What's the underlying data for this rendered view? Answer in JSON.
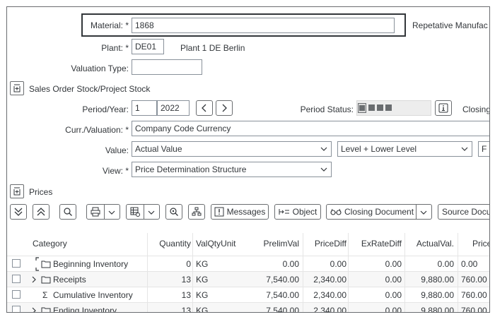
{
  "header": {
    "material_label": "Material: *",
    "material_value": "1868",
    "repetitive_label": "Repetative Manufac",
    "plant_label": "Plant: *",
    "plant_value": "DE01",
    "plant_desc": "Plant 1 DE Berlin",
    "valuation_type_label": "Valuation Type:",
    "valuation_type_value": "",
    "sales_order_section": "Sales Order Stock/Project Stock",
    "period_label": "Period/Year:",
    "period_value": "1",
    "year_value": "2022",
    "period_status_label": "Period Status:",
    "closing_label": "Closing",
    "curr_label": "Curr./Valuation: *",
    "curr_value": "Company Code Currency",
    "value_label": "Value:",
    "value_value": "Actual Value",
    "level_value": "Level + Lower Level",
    "extra_value": "F",
    "view_label": "View: *",
    "view_value": "Price Determination Structure",
    "prices_section": "Prices"
  },
  "toolbar": {
    "messages": "Messages",
    "object": "Object",
    "closing_document": "Closing Document",
    "source_doc": "Source Docu"
  },
  "table": {
    "headers": [
      "Category",
      "Quantity",
      "ValQtyUnit",
      "PrelimVal",
      "PriceDiff",
      "ExRateDiff",
      "ActualVal.",
      "Price"
    ],
    "rows": [
      {
        "category": "Beginning Inventory",
        "quantity": "0",
        "unit": "KG",
        "prelim": "0.00",
        "pricediff": "0.00",
        "exrate": "0.00",
        "actual": "0.00",
        "price": "0.00"
      },
      {
        "category": "Receipts",
        "quantity": "13",
        "unit": "KG",
        "prelim": "7,540.00",
        "pricediff": "2,340.00",
        "exrate": "0.00",
        "actual": "9,880.00",
        "price": "760.00"
      },
      {
        "category": "Cumulative Inventory",
        "quantity": "13",
        "unit": "KG",
        "prelim": "7,540.00",
        "pricediff": "2,340.00",
        "exrate": "0.00",
        "actual": "9,880.00",
        "price": "760.00"
      },
      {
        "category": "Ending Inventory",
        "quantity": "13",
        "unit": "KG",
        "prelim": "7,540.00",
        "pricediff": "2,340.00",
        "exrate": "0.00",
        "actual": "9,880.00",
        "price": "760.00"
      }
    ]
  },
  "colors": {
    "highlight_border": "#32363a",
    "status_grey": "#6a6d70"
  }
}
